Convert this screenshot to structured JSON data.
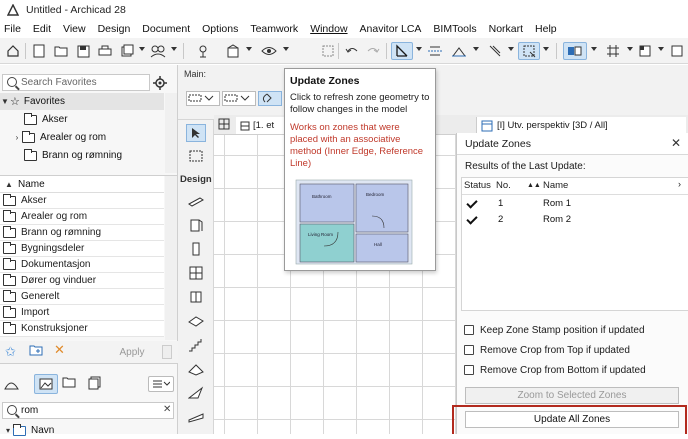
{
  "window": {
    "title": "Untitled - Archicad 28"
  },
  "menu": [
    "File",
    "Edit",
    "View",
    "Design",
    "Document",
    "Options",
    "Teamwork",
    "Window",
    "Anavitor LCA",
    "BIMTools",
    "Norkart",
    "Help"
  ],
  "favorites": {
    "search_placeholder": "Search Favorites",
    "root_label": "Favorites",
    "items": [
      "Akser",
      "Arealer og rom",
      "Brann og rømning"
    ]
  },
  "library": {
    "column_name": "Name",
    "items": [
      "Akser",
      "Arealer og rom",
      "Brann og rømning",
      "Bygningsdeler",
      "Dokumentasjon",
      "Dører og vinduer",
      "Generelt",
      "Import",
      "Konstruksjoner"
    ],
    "apply_label": "Apply",
    "search_value": "rom",
    "bottom_item": "Navn"
  },
  "infobox": {
    "label": "Main:"
  },
  "toolbox": {
    "label": "Design"
  },
  "tabs": {
    "floorplan_label": "[1. et",
    "perspective_label": "[I] Utv. perspektiv [3D / All]"
  },
  "tooltip": {
    "title": "Update Zones",
    "description": "Click to refresh zone geometry to follow changes in the model",
    "note": "Works on zones that were placed with an associative method (Inner Edge, Reference Line)",
    "room_labels": [
      "Bathroom",
      "Bedroom",
      "Living Room",
      "Hall"
    ]
  },
  "update_zones": {
    "header": "Update Zones",
    "results_label": "Results of the Last Update:",
    "columns": {
      "status": "Status",
      "no": "No.",
      "name": "Name"
    },
    "rows": [
      {
        "no": "1",
        "name": "Rom 1"
      },
      {
        "no": "2",
        "name": "Rom 2"
      }
    ],
    "options": [
      "Keep Zone Stamp position if updated",
      "Remove Crop from Top if updated",
      "Remove Crop from Bottom if updated"
    ],
    "zoom_button": "Zoom to Selected Zones",
    "update_all_button": "Update All Zones"
  },
  "colors": {
    "highlight": "#b22a1e",
    "accent": "#2d6db5",
    "note": "#c0392b"
  }
}
